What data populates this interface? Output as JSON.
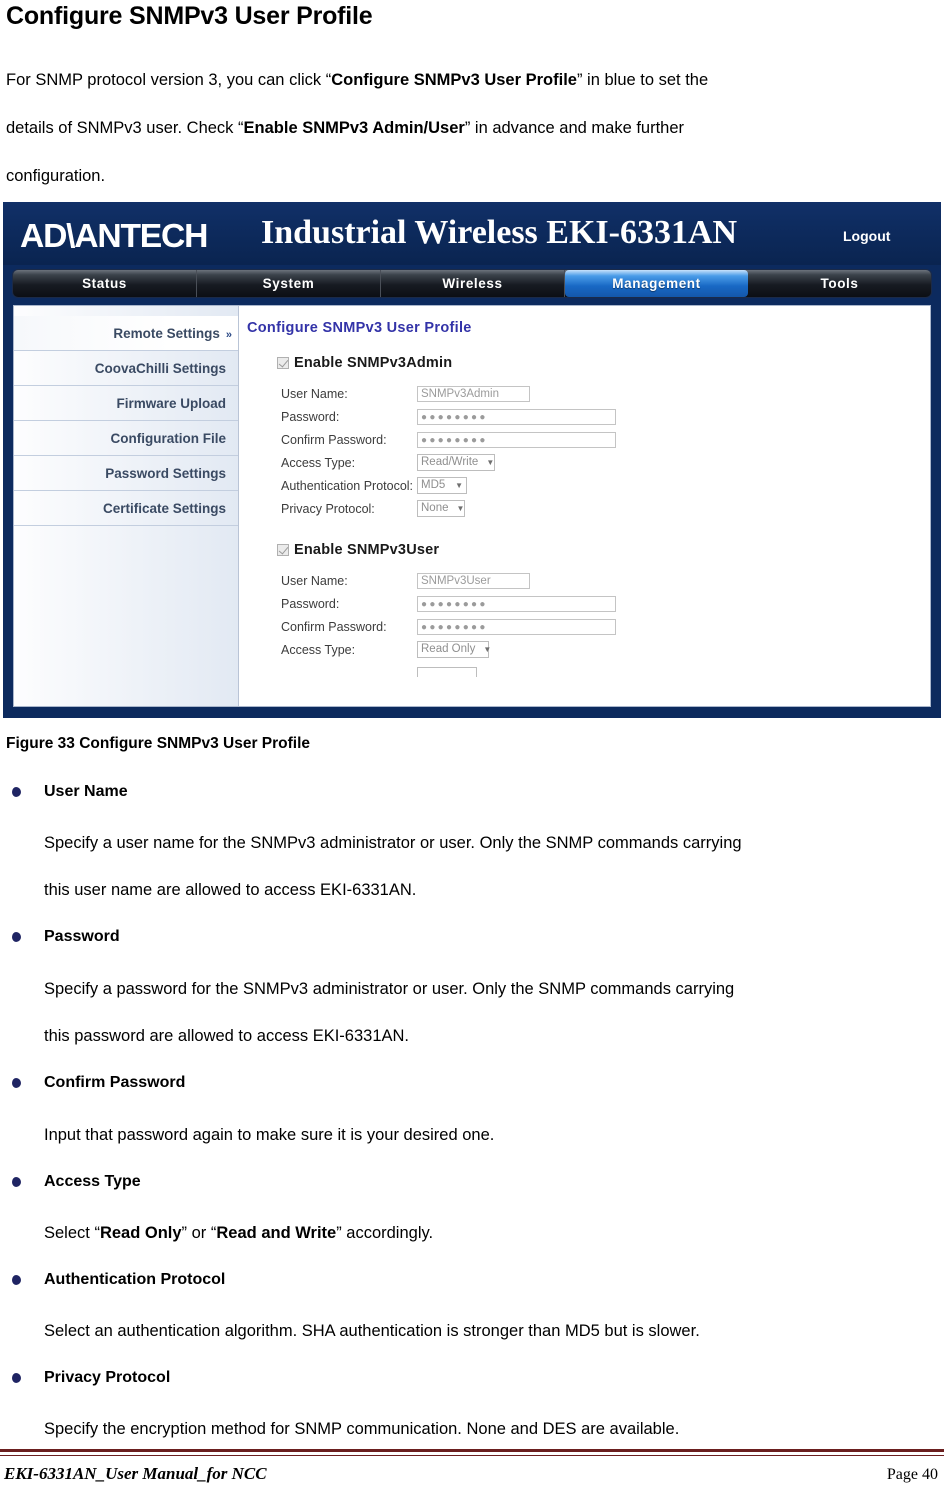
{
  "document": {
    "heading": "Configure SNMPv3 User Profile",
    "paragraph": {
      "line1_a": "For SNMP protocol version 3, you can click “",
      "line1_b": "Configure SNMPv3 User Profile",
      "line1_c": "” in blue to set the",
      "line2_a": "details of SNMPv3 user. Check “",
      "line2_b": "Enable SNMPv3 Admin",
      "line2_c": "/",
      "line2_d": "User",
      "line2_e": "” in advance and make further",
      "line3": "configuration."
    },
    "figure_caption": "Figure 33 Configure SNMPv3 User Profile"
  },
  "screenshot": {
    "header": {
      "brand": "AD\\ANTECH",
      "product": "Industrial Wireless EKI-6331AN",
      "logout_label": "Logout"
    },
    "nav_tabs": [
      {
        "label": "Status",
        "active": false
      },
      {
        "label": "System",
        "active": false
      },
      {
        "label": "Wireless",
        "active": false
      },
      {
        "label": "Management",
        "active": true
      },
      {
        "label": "Tools",
        "active": false
      }
    ],
    "sidebar": {
      "items": [
        {
          "label": "Remote Settings",
          "chevron": "»"
        },
        {
          "label": "CoovaChilli Settings"
        },
        {
          "label": "Firmware Upload"
        },
        {
          "label": "Configuration File"
        },
        {
          "label": "Password Settings"
        },
        {
          "label": "Certificate Settings"
        }
      ]
    },
    "content": {
      "title": "Configure SNMPv3 User Profile",
      "admin_section": {
        "checkbox_label": "Enable SNMPv3Admin",
        "checked": true,
        "fields": {
          "user_name_label": "User Name:",
          "user_name_value": "SNMPv3Admin",
          "password_label": "Password:",
          "password_value": "●●●●●●●●",
          "confirm_label": "Confirm Password:",
          "confirm_value": "●●●●●●●●",
          "access_type_label": "Access Type:",
          "access_type_value": "Read/Write",
          "auth_protocol_label": "Authentication Protocol:",
          "auth_protocol_value": "MD5",
          "privacy_protocol_label": "Privacy Protocol:",
          "privacy_protocol_value": "None"
        }
      },
      "user_section": {
        "checkbox_label": "Enable SNMPv3User",
        "checked": true,
        "fields": {
          "user_name_label": "User Name:",
          "user_name_value": "SNMPv3User",
          "password_label": "Password:",
          "password_value": "●●●●●●●●",
          "confirm_label": "Confirm Password:",
          "confirm_value": "●●●●●●●●",
          "access_type_label": "Access Type:",
          "access_type_value": "Read Only"
        }
      },
      "caret_glyph": "▼"
    },
    "colors": {
      "header_blue": "#0c2a5e",
      "active_tab_blue": "#1868c4",
      "title_purple": "#3333a8"
    }
  },
  "bullets": [
    {
      "title": "User Name",
      "body_line1": "Specify a user name for the SNMPv3 administrator or user. Only the SNMP commands carrying",
      "body_line2": "this user name are allowed to access EKI-6331AN."
    },
    {
      "title": "Password",
      "body_line1": "Specify a password for the SNMPv3 administrator or user. Only the SNMP commands carrying",
      "body_line2": "this password are allowed to access EKI-6331AN."
    },
    {
      "title": "Confirm Password",
      "body_line1": "Input that password again to make sure it is your desired one.",
      "body_line2": ""
    },
    {
      "title": "Access Type",
      "body_sel_a": "Select “",
      "body_sel_b": "Read Only",
      "body_sel_c": "” or “",
      "body_sel_d": "Read and Write",
      "body_sel_e": "” accordingly."
    },
    {
      "title": "Authentication Protocol",
      "body_line1": "Select an authentication algorithm. SHA authentication is stronger than MD5 but is slower.",
      "body_line2": ""
    },
    {
      "title": "Privacy Protocol",
      "body_line1": "Specify the encryption method for SNMP communication. None and DES are available.",
      "body_line2": ""
    }
  ],
  "footer": {
    "left": "EKI-6331AN_User Manual_for NCC",
    "right": "Page 40"
  }
}
